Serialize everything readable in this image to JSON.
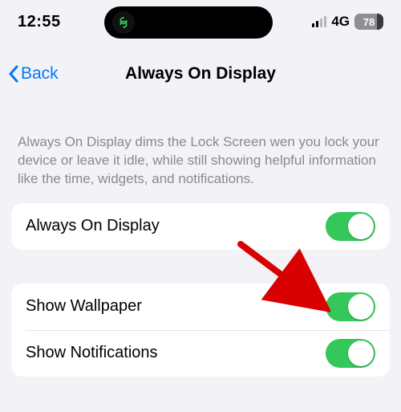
{
  "status": {
    "time": "12:55",
    "network": "4G",
    "battery_percent": "78",
    "signal_strength": 2
  },
  "nav": {
    "back_label": "Back",
    "title": "Always On Display"
  },
  "description": "Always On Display dims the Lock Screen wen you lock your device or leave it idle, while still showing helpful information like the time, widgets, and notifications.",
  "sections": [
    {
      "rows": [
        {
          "label": "Always On Display",
          "on": true
        }
      ]
    },
    {
      "rows": [
        {
          "label": "Show Wallpaper",
          "on": true
        },
        {
          "label": "Show Notifications",
          "on": true
        }
      ]
    }
  ],
  "colors": {
    "accent": "#007aff",
    "toggle_on": "#34c759",
    "annotation": "#d80000"
  }
}
